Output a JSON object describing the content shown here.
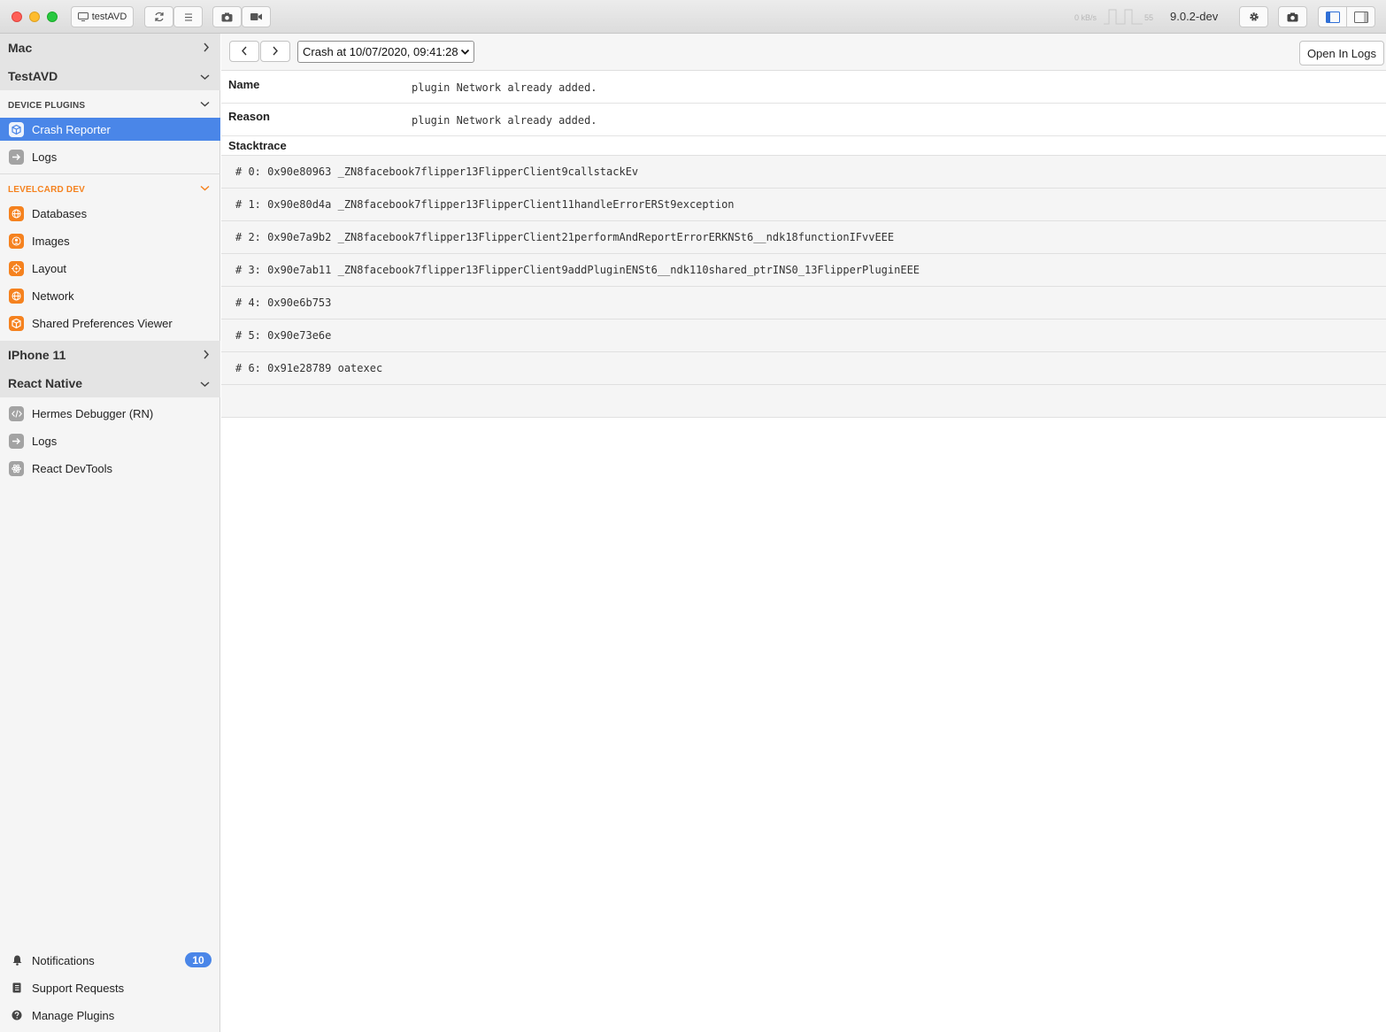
{
  "titlebar": {
    "device_label": "testAVD",
    "perf_kbs": "0 kB/s",
    "perf_fps": "55",
    "version": "9.0.2-dev"
  },
  "sidebar": {
    "sections": {
      "mac": "Mac",
      "testavd": "TestAVD",
      "iphone": "IPhone 11",
      "react_native": "React Native"
    },
    "device_plugins_header": "DEVICE PLUGINS",
    "device_plugins": [
      {
        "label": "Crash Reporter",
        "icon": "box-icon"
      },
      {
        "label": "Logs",
        "icon": "arrow-right-icon"
      }
    ],
    "levelcard_header": "LEVELCARD DEV",
    "levelcard_plugins": [
      {
        "label": "Databases",
        "icon": "globe-icon"
      },
      {
        "label": "Images",
        "icon": "person-icon"
      },
      {
        "label": "Layout",
        "icon": "target-icon"
      },
      {
        "label": "Network",
        "icon": "globe-icon"
      },
      {
        "label": "Shared Preferences Viewer",
        "icon": "box-icon"
      }
    ],
    "rn_plugins": [
      {
        "label": "Hermes Debugger (RN)",
        "icon": "code-icon"
      },
      {
        "label": "Logs",
        "icon": "arrow-right-icon"
      },
      {
        "label": "React DevTools",
        "icon": "atom-icon"
      }
    ],
    "bottom": {
      "notifications": "Notifications",
      "notifications_count": "10",
      "support": "Support Requests",
      "manage": "Manage Plugins"
    }
  },
  "main": {
    "crash_selector": "Crash at 10/07/2020, 09:41:28",
    "open_in_logs": "Open In Logs",
    "name_label": "Name",
    "name_value": "plugin Network already added.",
    "reason_label": "Reason",
    "reason_value": "plugin Network already added.",
    "stacktrace_label": "Stacktrace",
    "stacktrace": [
      "# 0: 0x90e80963 _ZN8facebook7flipper13FlipperClient9callstackEv",
      "# 1: 0x90e80d4a _ZN8facebook7flipper13FlipperClient11handleErrorERSt9exception",
      "# 2: 0x90e7a9b2 _ZN8facebook7flipper13FlipperClient21performAndReportErrorERKNSt6__ndk18functionIFvvEEE",
      "# 3: 0x90e7ab11 _ZN8facebook7flipper13FlipperClient9addPluginENSt6__ndk110shared_ptrINS0_13FlipperPluginEEE",
      "# 4: 0x90e6b753",
      "# 5: 0x90e73e6e",
      "# 6: 0x91e28789 oatexec",
      ""
    ]
  },
  "colors": {
    "accent": "#4a86e8",
    "orange": "#f5821f"
  }
}
